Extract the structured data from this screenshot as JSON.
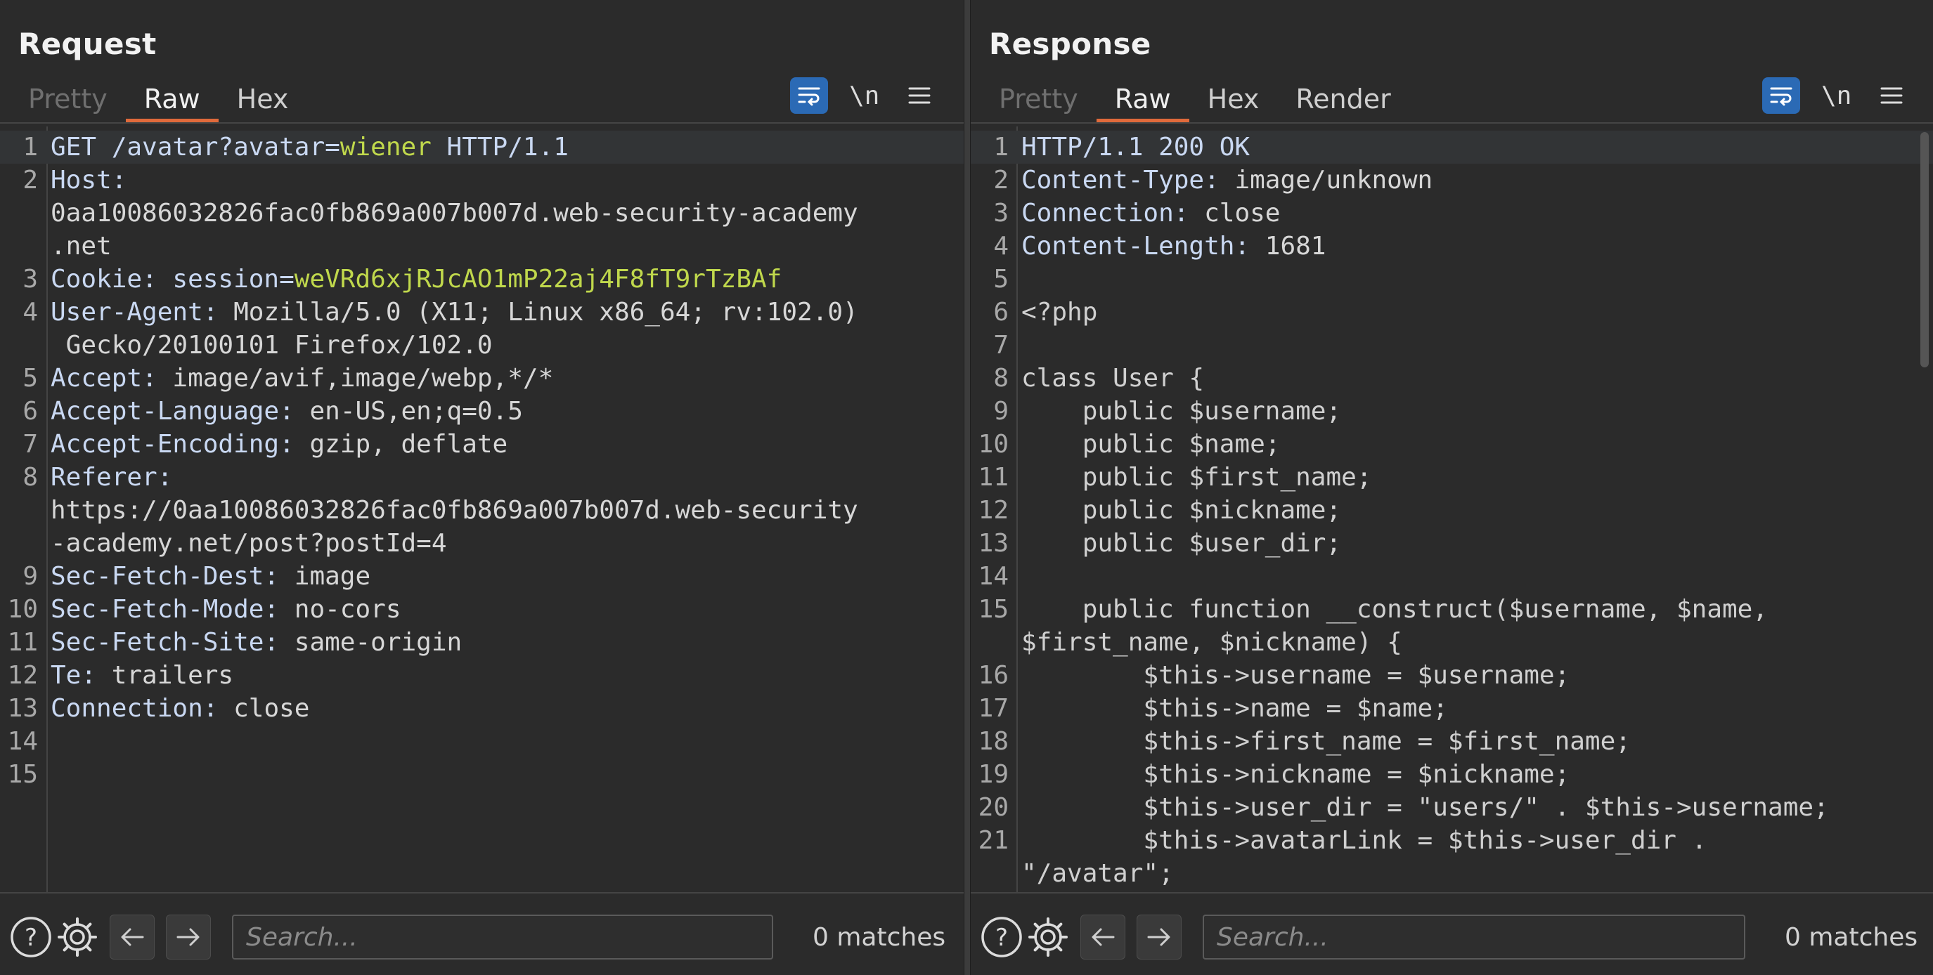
{
  "colors": {
    "accent": "#e06a3b",
    "toggle_on": "#2b6ab5",
    "header_value": "#c0d84c",
    "header_key": "#c9d8f2"
  },
  "layout_buttons": [
    "split-vertical-icon",
    "split-horizontal-icon",
    "single-pane-icon"
  ],
  "request": {
    "title": "Request",
    "tabs": [
      "Pretty",
      "Raw",
      "Hex"
    ],
    "active_tab": "Raw",
    "toolbar": {
      "newline_label": "\\n",
      "icons": [
        "wrap-lines-icon",
        "menu-icon"
      ]
    },
    "lines": [
      {
        "num": "1",
        "parts": [
          [
            "GET /avatar?avatar=",
            "k"
          ],
          [
            "wiener",
            "g"
          ],
          [
            " HTTP/1.1",
            "k"
          ]
        ]
      },
      {
        "num": "2",
        "parts": [
          [
            "Host:",
            "k"
          ]
        ]
      },
      {
        "num": "",
        "parts": [
          [
            "0aa10086032826fac0fb869a007b007d.web-security-academy",
            "hv"
          ]
        ]
      },
      {
        "num": "",
        "parts": [
          [
            ".net",
            "hv"
          ]
        ]
      },
      {
        "num": "3",
        "parts": [
          [
            "Cookie: ",
            "k"
          ],
          [
            "session=",
            "k"
          ],
          [
            "weVRd6xjRJcAO1mP22aj4F8fT9rTzBAf",
            "g"
          ]
        ]
      },
      {
        "num": "4",
        "parts": [
          [
            "User-Agent: ",
            "k"
          ],
          [
            "Mozilla/5.0 (X11; Linux x86_64; rv:102.0)",
            "hv"
          ]
        ]
      },
      {
        "num": "",
        "parts": [
          [
            " Gecko/20100101 Firefox/102.0",
            "hv"
          ]
        ]
      },
      {
        "num": "5",
        "parts": [
          [
            "Accept: ",
            "k"
          ],
          [
            "image/avif,image/webp,*/*",
            "hv"
          ]
        ]
      },
      {
        "num": "6",
        "parts": [
          [
            "Accept-Language: ",
            "k"
          ],
          [
            "en-US,en;q=0.5",
            "hv"
          ]
        ]
      },
      {
        "num": "7",
        "parts": [
          [
            "Accept-Encoding: ",
            "k"
          ],
          [
            "gzip, deflate",
            "hv"
          ]
        ]
      },
      {
        "num": "8",
        "parts": [
          [
            "Referer:",
            "k"
          ]
        ]
      },
      {
        "num": "",
        "parts": [
          [
            "https://0aa10086032826fac0fb869a007b007d.web-security",
            "hv"
          ]
        ]
      },
      {
        "num": "",
        "parts": [
          [
            "-academy.net/post?postId=4",
            "hv"
          ]
        ]
      },
      {
        "num": "9",
        "parts": [
          [
            "Sec-Fetch-Dest: ",
            "k"
          ],
          [
            "image",
            "hv"
          ]
        ]
      },
      {
        "num": "10",
        "parts": [
          [
            "Sec-Fetch-Mode: ",
            "k"
          ],
          [
            "no-cors",
            "hv"
          ]
        ]
      },
      {
        "num": "11",
        "parts": [
          [
            "Sec-Fetch-Site: ",
            "k"
          ],
          [
            "same-origin",
            "hv"
          ]
        ]
      },
      {
        "num": "12",
        "parts": [
          [
            "Te: ",
            "k"
          ],
          [
            "trailers",
            "hv"
          ]
        ]
      },
      {
        "num": "13",
        "parts": [
          [
            "Connection: ",
            "k"
          ],
          [
            "close",
            "hv"
          ]
        ]
      },
      {
        "num": "14",
        "parts": []
      },
      {
        "num": "15",
        "parts": []
      }
    ],
    "search": {
      "placeholder": "Search...",
      "value": "",
      "matches": "0 matches"
    }
  },
  "response": {
    "title": "Response",
    "tabs": [
      "Pretty",
      "Raw",
      "Hex",
      "Render"
    ],
    "active_tab": "Raw",
    "toolbar": {
      "newline_label": "\\n",
      "icons": [
        "wrap-lines-icon",
        "menu-icon"
      ]
    },
    "lines": [
      {
        "num": "1",
        "parts": [
          [
            "HTTP/1.1 200 OK",
            "k"
          ]
        ]
      },
      {
        "num": "2",
        "parts": [
          [
            "Content-Type: ",
            "k"
          ],
          [
            "image/unknown",
            "hv"
          ]
        ]
      },
      {
        "num": "3",
        "parts": [
          [
            "Connection: ",
            "k"
          ],
          [
            "close",
            "hv"
          ]
        ]
      },
      {
        "num": "4",
        "parts": [
          [
            "Content-Length: ",
            "k"
          ],
          [
            "1681",
            "hv"
          ]
        ]
      },
      {
        "num": "5",
        "parts": []
      },
      {
        "num": "6",
        "parts": [
          [
            "<?php",
            "lnb"
          ]
        ]
      },
      {
        "num": "7",
        "parts": []
      },
      {
        "num": "8",
        "parts": [
          [
            "class User {",
            "lnb"
          ]
        ]
      },
      {
        "num": "9",
        "parts": [
          [
            "    public $username;",
            "lnb"
          ]
        ]
      },
      {
        "num": "10",
        "parts": [
          [
            "    public $name;",
            "lnb"
          ]
        ]
      },
      {
        "num": "11",
        "parts": [
          [
            "    public $first_name;",
            "lnb"
          ]
        ]
      },
      {
        "num": "12",
        "parts": [
          [
            "    public $nickname;",
            "lnb"
          ]
        ]
      },
      {
        "num": "13",
        "parts": [
          [
            "    public $user_dir;",
            "lnb"
          ]
        ]
      },
      {
        "num": "14",
        "parts": []
      },
      {
        "num": "15",
        "parts": [
          [
            "    public function __construct($username, $name,",
            "lnb"
          ]
        ]
      },
      {
        "num": "",
        "parts": [
          [
            "$first_name, $nickname) {",
            "lnb"
          ]
        ]
      },
      {
        "num": "16",
        "parts": [
          [
            "        $this->username = $username;",
            "lnb"
          ]
        ]
      },
      {
        "num": "17",
        "parts": [
          [
            "        $this->name = $name;",
            "lnb"
          ]
        ]
      },
      {
        "num": "18",
        "parts": [
          [
            "        $this->first_name = $first_name;",
            "lnb"
          ]
        ]
      },
      {
        "num": "19",
        "parts": [
          [
            "        $this->nickname = $nickname;",
            "lnb"
          ]
        ]
      },
      {
        "num": "20",
        "parts": [
          [
            "        $this->user_dir = \"users/\" . $this->username;",
            "lnb"
          ]
        ]
      },
      {
        "num": "21",
        "parts": [
          [
            "        $this->avatarLink = $this->user_dir .",
            "lnb"
          ]
        ]
      },
      {
        "num": "",
        "parts": [
          [
            "\"/avatar\";",
            "lnb"
          ]
        ]
      }
    ],
    "search": {
      "placeholder": "Search...",
      "value": "",
      "matches": "0 matches"
    }
  }
}
